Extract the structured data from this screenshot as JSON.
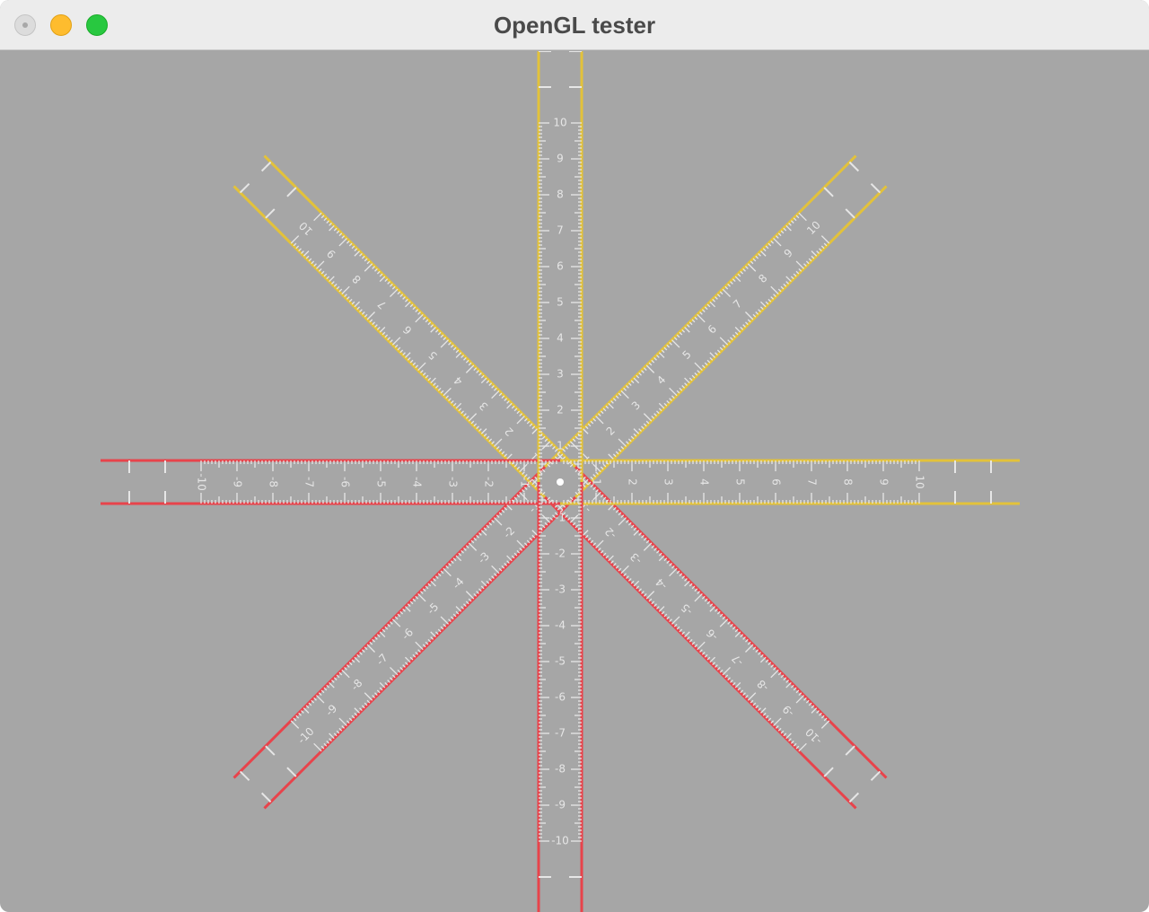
{
  "window": {
    "title": "OpenGL tester",
    "controls": [
      "close-button",
      "minimize-button",
      "zoom-button"
    ]
  },
  "scene": {
    "background_color": "#a6a6a6",
    "positive_color": "#e3c23a",
    "negative_color": "#e8434b",
    "tick_color": "#e6e6e6",
    "ruler_angles_deg": [
      0,
      45,
      90,
      135
    ],
    "range": [
      -10,
      10
    ],
    "tick_labels": [
      "-10",
      "-9",
      "-8",
      "-7",
      "-6",
      "-5",
      "-4",
      "-3",
      "-2",
      "-1",
      "1",
      "2",
      "3",
      "4",
      "5",
      "6",
      "7",
      "8",
      "9",
      "10"
    ],
    "center_marker": "origin-dot"
  }
}
